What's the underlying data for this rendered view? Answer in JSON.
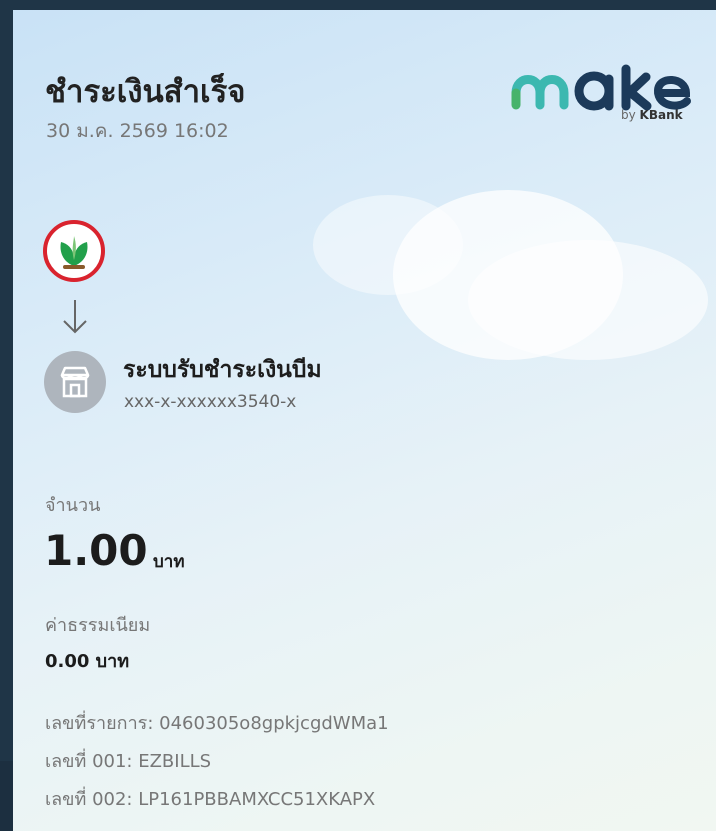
{
  "slip": {
    "title": "ชำระเงินสำเร็จ",
    "datetime": "30 ม.ค. 2569 16:02"
  },
  "brand": {
    "logo_text": "make",
    "by_text": "by",
    "bank_text": "KBank",
    "colors": {
      "logo_teal": "#3cb8b0",
      "logo_green": "#47b36b",
      "logo_navy": "#1c3a5a",
      "kbank_green": "#22a04b",
      "kbank_red": "#d9232e"
    }
  },
  "sender": {
    "icon": "kbank-logo-icon"
  },
  "transfer": {
    "icon": "arrow-down-icon"
  },
  "merchant": {
    "icon": "store-icon",
    "name": "ระบบรับชำระเงินบีม",
    "account": "xxx-x-xxxxxx3540-x"
  },
  "amount": {
    "label": "จำนวน",
    "value": "1.00",
    "unit": "บาท"
  },
  "fee": {
    "label": "ค่าธรรมเนียม",
    "value": "0.00 บาท"
  },
  "references": [
    "เลขที่รายการ: 0460305o8gpkjcgdWMa1",
    "เลขที่ 001: EZBILLS",
    "เลขที่ 002: LP161PBBAMXCC51XKAPX"
  ]
}
